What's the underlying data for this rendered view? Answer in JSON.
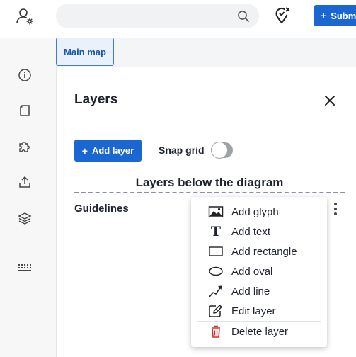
{
  "header": {
    "search": {
      "value": "",
      "placeholder": ""
    },
    "submit_label": "Subm",
    "icons": {
      "user": "user-settings-icon",
      "search": "search-icon",
      "location": "location-off-icon",
      "plus": "+"
    }
  },
  "rail": {
    "icons": [
      "info-icon",
      "page-icon",
      "puzzle-icon",
      "share-icon",
      "layers-icon",
      "keyboard-icon"
    ]
  },
  "tabs": [
    {
      "label": "Main map"
    }
  ],
  "layers_panel": {
    "title": "Layers",
    "add_layer_label": "Add layer",
    "add_layer_plus": "+",
    "snap_grid_label": "Snap grid",
    "snap_grid_on": false,
    "section_title": "Layers below the diagram",
    "layers": [
      {
        "name": "Guidelines"
      }
    ]
  },
  "layer_menu": {
    "items": [
      {
        "label": "Add glyph",
        "icon": "image-icon"
      },
      {
        "label": "Add text",
        "icon": "text-icon"
      },
      {
        "label": "Add rectangle",
        "icon": "rectangle-icon"
      },
      {
        "label": "Add oval",
        "icon": "oval-icon"
      },
      {
        "label": "Add line",
        "icon": "line-icon"
      },
      {
        "label": "Edit layer",
        "icon": "edit-icon"
      },
      {
        "label": "Delete layer",
        "icon": "trash-icon"
      }
    ],
    "icon_text_glyph": "T"
  },
  "colors": {
    "accent": "#1a66d2",
    "danger": "#d62b2b",
    "toggle_off": "#9ea3ab"
  }
}
